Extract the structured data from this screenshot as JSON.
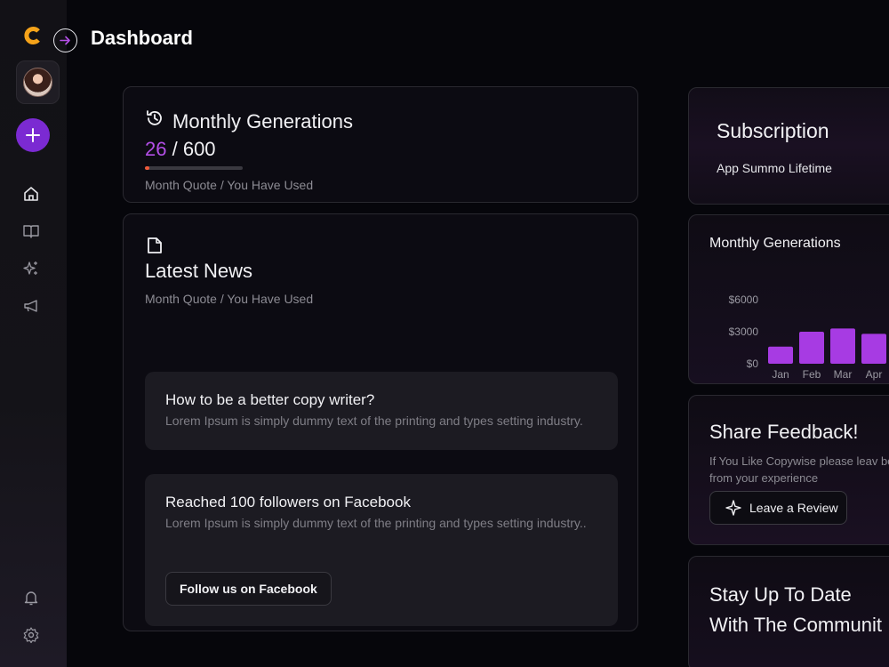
{
  "header": {
    "title": "Dashboard"
  },
  "sidebar": {
    "logo": "C",
    "items": [
      {
        "name": "home",
        "icon": "home-icon"
      },
      {
        "name": "library",
        "icon": "book-icon"
      },
      {
        "name": "magic",
        "icon": "sparkles-icon"
      },
      {
        "name": "announcements",
        "icon": "megaphone-icon"
      }
    ],
    "bottom_items": [
      {
        "name": "notifications",
        "icon": "bell-icon"
      },
      {
        "name": "settings",
        "icon": "gear-icon"
      }
    ]
  },
  "generations": {
    "title": "Monthly Generations",
    "used": "26",
    "total": "/ 600",
    "progress_fraction": 0.043,
    "caption": "Month Quote / You Have Used"
  },
  "news": {
    "title": "Latest News",
    "caption": "Month Quote / You Have Used",
    "items": [
      {
        "title": "How to be a better copy writer?",
        "text": "Lorem Ipsum is simply dummy text of the printing and types setting industry."
      },
      {
        "title": "Reached 100 followers on Facebook",
        "text": "Lorem Ipsum is simply dummy text of the printing and types setting industry..",
        "button": "Follow us on Facebook"
      }
    ]
  },
  "subscription": {
    "title": "Subscription",
    "plan": "App Summo Lifetime"
  },
  "chart_card": {
    "title": "Monthly Generations"
  },
  "chart_data": {
    "type": "bar",
    "title": "Monthly Generations",
    "categories": [
      "Jan",
      "Feb",
      "Mar",
      "Apr"
    ],
    "values": [
      1600,
      3000,
      3300,
      2800
    ],
    "y_ticks": [
      "$0",
      "$3000",
      "$6000"
    ],
    "ylim": [
      0,
      6000
    ],
    "grid": false,
    "bar_color": "#a73be3"
  },
  "feedback": {
    "title": "Share Feedback!",
    "text": "If You Like Copywise please leav benefit from your experience",
    "button": "Leave a Review"
  },
  "community": {
    "title_line1": "Stay Up To Date",
    "title_line2": "With The Communit"
  },
  "colors": {
    "accent": "#7b2ad2",
    "highlight": "#b44fe8",
    "progress": "#f05a3a",
    "logo": "#f5a31a"
  }
}
